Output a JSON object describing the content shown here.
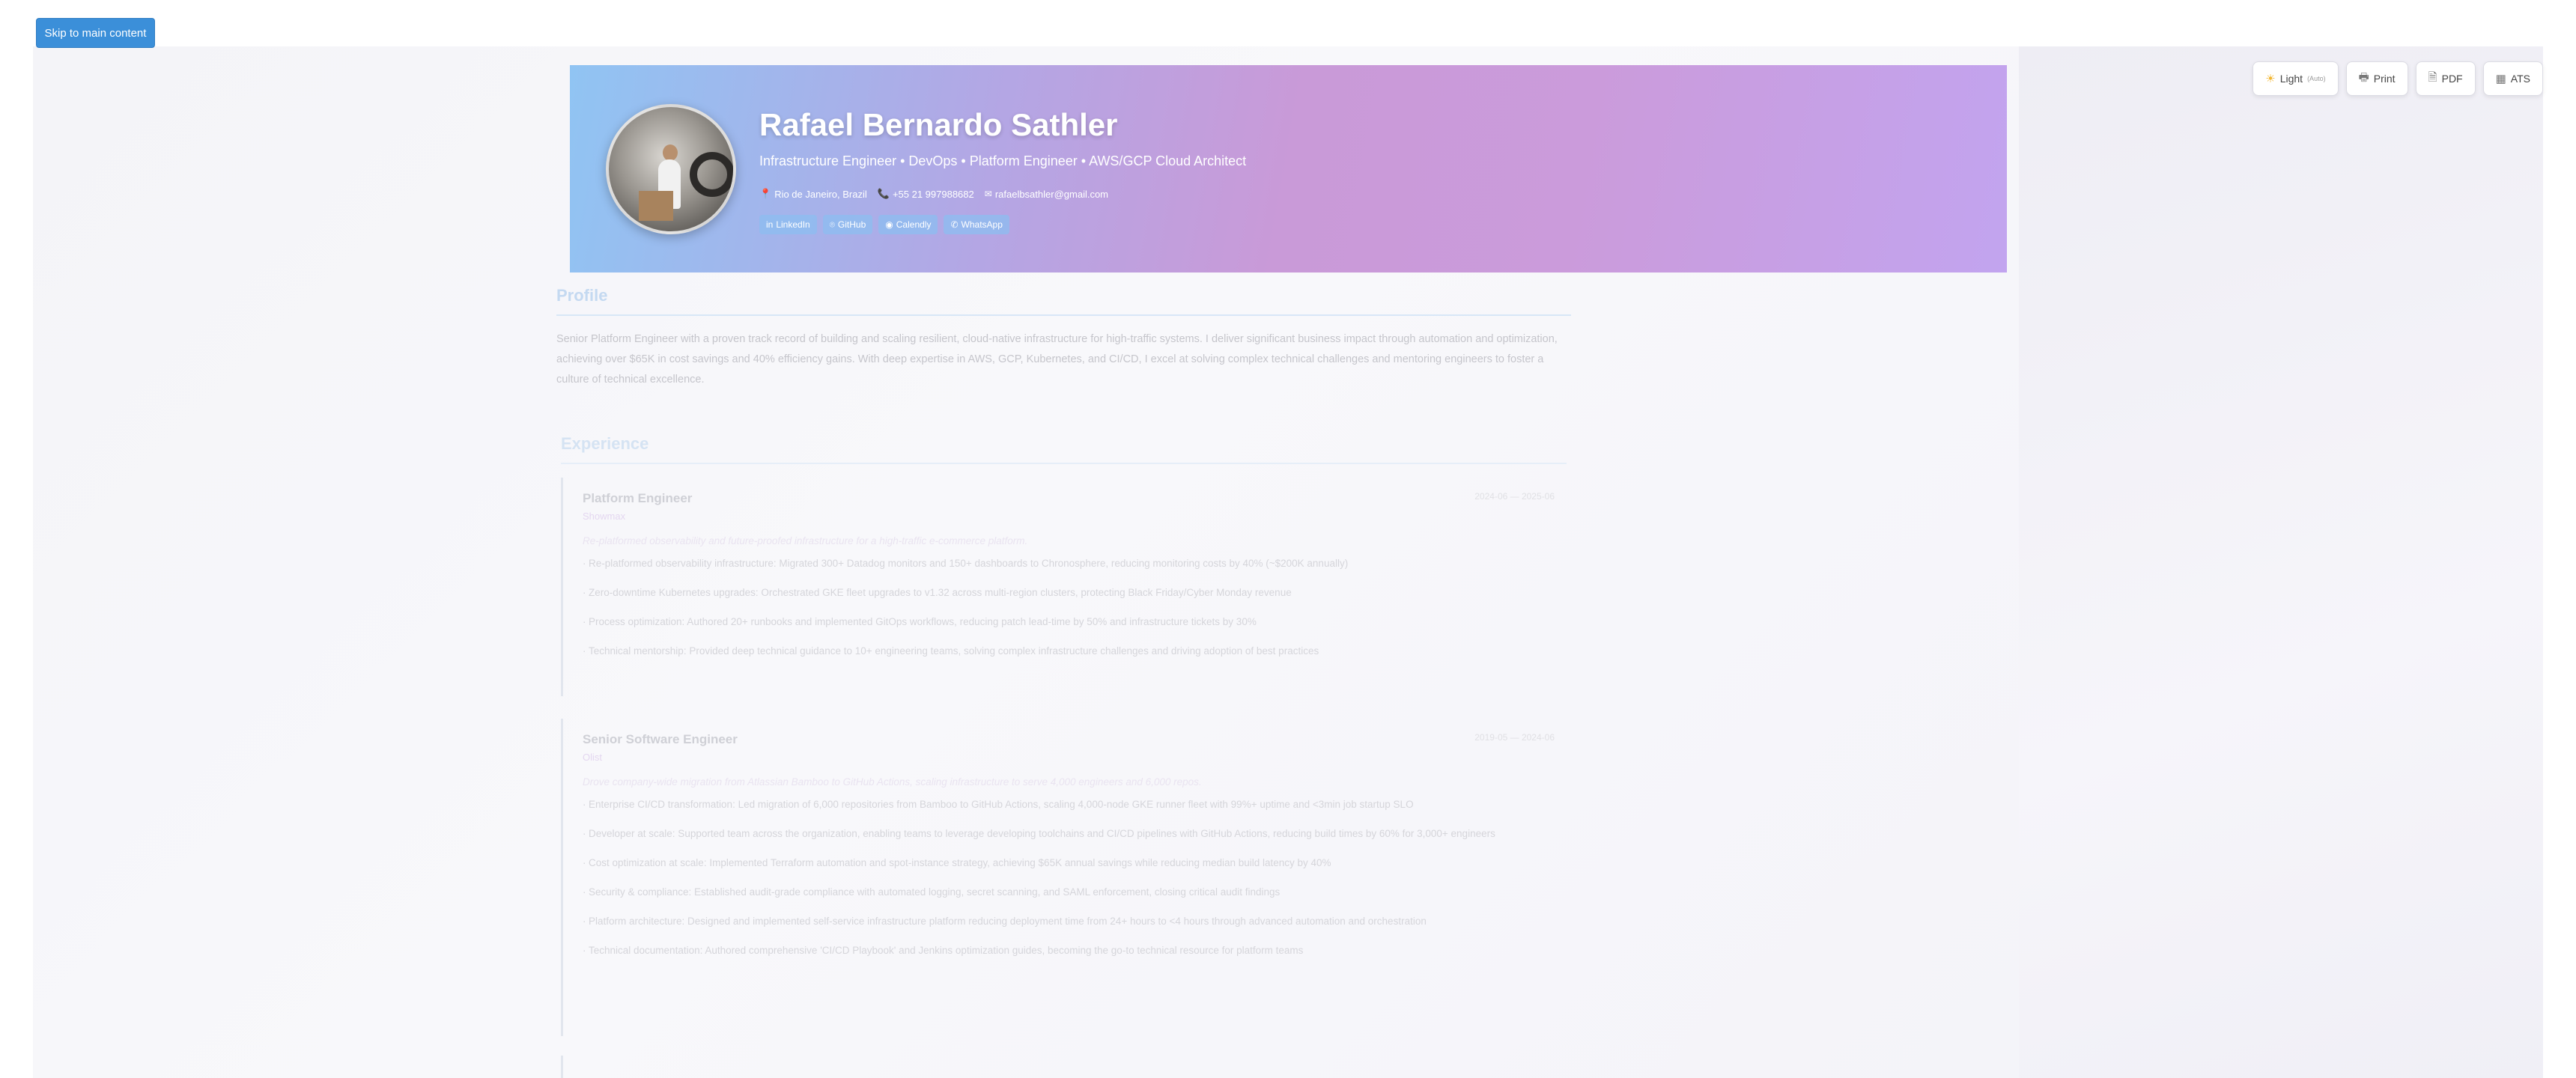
{
  "skip_link": "Skip to main content",
  "toolbar": {
    "theme_label": "Light",
    "theme_sub": "(Auto)",
    "print_label": "Print",
    "pdf_label": "PDF",
    "ats_label": "ATS"
  },
  "hero": {
    "name": "Rafael Bernardo Sathler",
    "title": "Infrastructure Engineer • DevOps • Platform Engineer • AWS/GCP Cloud Architect",
    "location": "Rio de Janeiro, Brazil",
    "phone": "+55 21 997988682",
    "email": "rafaelbsathler@gmail.com",
    "social": [
      "LinkedIn",
      "GitHub",
      "Calendly",
      "WhatsApp"
    ]
  },
  "profile": {
    "heading": "Profile",
    "text": "Senior Platform Engineer with a proven track record of building and scaling resilient, cloud-native infrastructure for high-traffic systems. I deliver significant business impact through automation and optimization, achieving over $65K in cost savings and 40% efficiency gains. With deep expertise in AWS, GCP, Kubernetes, and CI/CD, I excel at solving complex technical challenges and mentoring engineers to foster a culture of technical excellence."
  },
  "experience": {
    "heading": "Experience",
    "jobs": [
      {
        "role": "Platform Engineer",
        "company": "Showmax",
        "dates": "2024-06 — 2025-06",
        "summary": "Re-platformed observability and future-proofed infrastructure for a high-traffic e-commerce platform.",
        "bullets": [
          "Re-platformed observability infrastructure: Migrated 300+ Datadog monitors and 150+ dashboards to Chronosphere, reducing monitoring costs by 40% (~$200K annually)",
          "Zero-downtime Kubernetes upgrades: Orchestrated GKE fleet upgrades to v1.32 across multi-region clusters, protecting Black Friday/Cyber Monday revenue",
          "Process optimization: Authored 20+ runbooks and implemented GitOps workflows, reducing patch lead-time by 50% and infrastructure tickets by 30%",
          "Technical mentorship: Provided deep technical guidance to 10+ engineering teams, solving complex infrastructure challenges and driving adoption of best practices"
        ]
      },
      {
        "role": "Senior Software Engineer",
        "company": "Olist",
        "dates": "2019-05 — 2024-06",
        "summary": "Drove company-wide migration from Atlassian Bamboo to GitHub Actions, scaling infrastructure to serve 4,000 engineers and 6,000 repos.",
        "bullets": [
          "Enterprise CI/CD transformation: Led migration of 6,000 repositories from Bamboo to GitHub Actions, scaling 4,000-node GKE runner fleet with 99%+ uptime and <3min job startup SLO",
          "Developer at scale: Supported team across the organization, enabling teams to leverage developing toolchains and CI/CD pipelines with GitHub Actions, reducing build times by 60% for 3,000+ engineers",
          "Cost optimization at scale: Implemented Terraform automation and spot-instance strategy, achieving $65K annual savings while reducing median build latency by 40%",
          "Security & compliance: Established audit-grade compliance with automated logging, secret scanning, and SAML enforcement, closing critical audit findings",
          "Platform architecture: Designed and implemented self-service infrastructure platform reducing deployment time from 24+ hours to <4 hours through advanced automation and orchestration",
          "Technical documentation: Authored comprehensive 'CI/CD Playbook' and Jenkins optimization guides, becoming the go-to technical resource for platform teams"
        ]
      },
      {
        "role": "",
        "company": "",
        "dates": "",
        "summary": "",
        "bullets": []
      }
    ]
  }
}
